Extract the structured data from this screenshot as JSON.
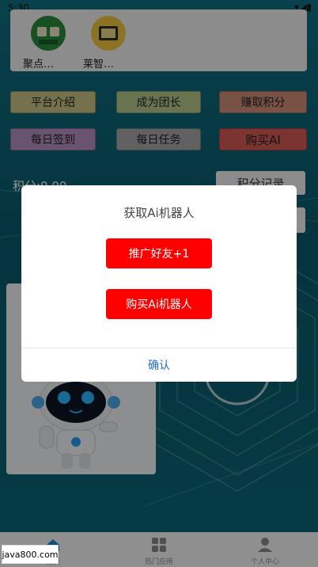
{
  "status_bar": {
    "time": "5:30"
  },
  "apps": [
    {
      "name": "聚点…"
    },
    {
      "name": "莱智…"
    }
  ],
  "grid_buttons": [
    {
      "label": "平台介绍",
      "color": "#c9c384"
    },
    {
      "label": "成为团长",
      "color": "#b3c88a"
    },
    {
      "label": "赚取积分",
      "color": "#cf8f78"
    },
    {
      "label": "每日签到",
      "color": "#b690c3"
    },
    {
      "label": "每日任务",
      "color": "#a7a7a7"
    },
    {
      "label": "购买AI",
      "color": "#d45a54"
    }
  ],
  "points_label": "积分:0.00",
  "points_record_button": "积分记录",
  "dialog": {
    "title": "获取Ai机器人",
    "btn_invite": "推广好友+1",
    "btn_buy": "购买Ai机器人",
    "confirm": "确认"
  },
  "tabs": [
    {
      "label": "首页"
    },
    {
      "label": "热门应用"
    },
    {
      "label": "个人中心"
    }
  ],
  "watermark": "java800.com"
}
